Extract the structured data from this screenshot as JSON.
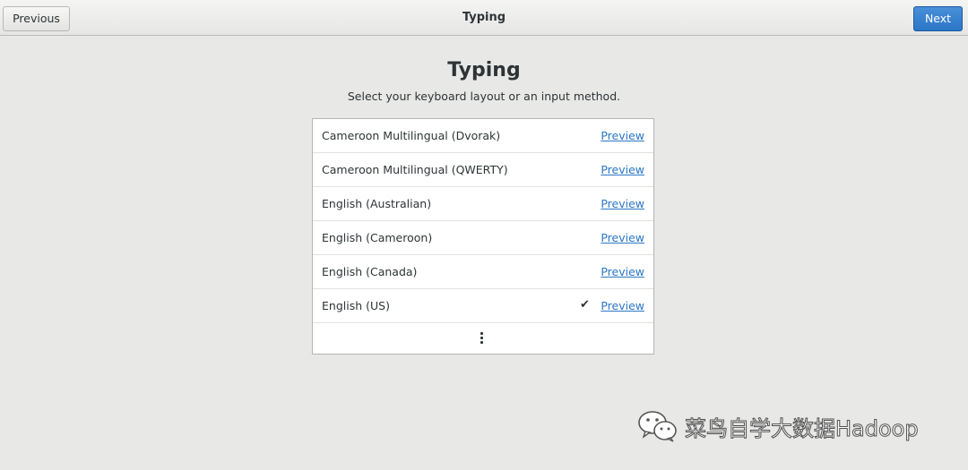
{
  "header": {
    "previous_label": "Previous",
    "title": "Typing",
    "next_label": "Next"
  },
  "page": {
    "title": "Typing",
    "subtitle": "Select your keyboard layout or an input method."
  },
  "layouts": [
    {
      "label": "Cameroon Multilingual (Dvorak)",
      "selected": false,
      "preview_label": "Preview"
    },
    {
      "label": "Cameroon Multilingual (QWERTY)",
      "selected": false,
      "preview_label": "Preview"
    },
    {
      "label": "English (Australian)",
      "selected": false,
      "preview_label": "Preview"
    },
    {
      "label": "English (Cameroon)",
      "selected": false,
      "preview_label": "Preview"
    },
    {
      "label": "English (Canada)",
      "selected": false,
      "preview_label": "Preview"
    },
    {
      "label": "English (US)",
      "selected": true,
      "preview_label": "Preview"
    }
  ],
  "check_glyph": "✔",
  "more_icon": "vertical-ellipsis-icon",
  "watermark": {
    "text": "菜鸟自学大数据Hadoop",
    "icon": "wechat-icon"
  },
  "colors": {
    "accent": "#2a76c6",
    "background": "#e8e8e7"
  }
}
